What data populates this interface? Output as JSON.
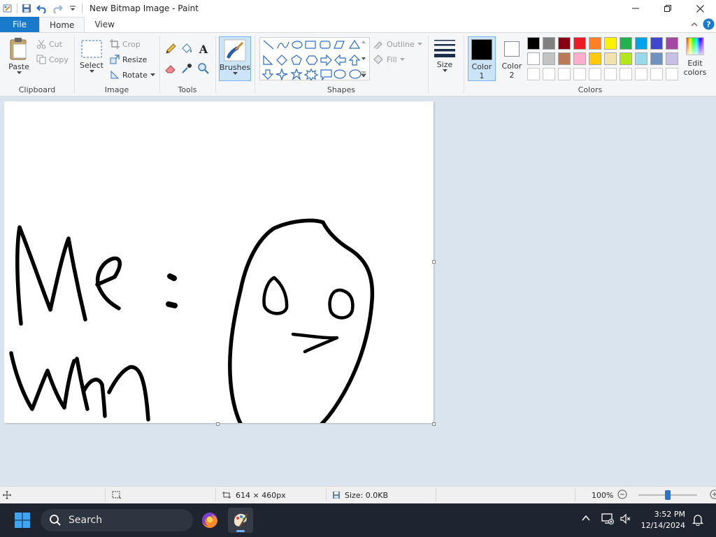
{
  "window": {
    "title": "New Bitmap Image - Paint",
    "buttons": {
      "minimize": "—",
      "maximize": "❐",
      "close": "✕"
    }
  },
  "menu": {
    "file": "File",
    "tabs": [
      "Home",
      "View"
    ]
  },
  "ribbon": {
    "clipboard": {
      "label": "Clipboard",
      "paste": "Paste",
      "cut": "Cut",
      "copy": "Copy"
    },
    "image": {
      "label": "Image",
      "select": "Select",
      "crop": "Crop",
      "resize": "Resize",
      "rotate": "Rotate"
    },
    "tools": {
      "label": "Tools",
      "brushes": "Brushes"
    },
    "shapes": {
      "label": "Shapes",
      "outline": "Outline",
      "fill": "Fill",
      "size": "Size"
    },
    "colors": {
      "label": "Colors",
      "color1_label": "Color",
      "color1_num": "1",
      "color2_label": "Color",
      "color2_num": "2",
      "edit_line1": "Edit",
      "edit_line2": "colors",
      "color1": "#000000",
      "color2": "#ffffff",
      "palette_row1": [
        "#000000",
        "#7f7f7f",
        "#880015",
        "#ed1c24",
        "#ff7f27",
        "#fff200",
        "#22b14c",
        "#00a2e8",
        "#3f48cc",
        "#a349a4"
      ],
      "palette_row2": [
        "#ffffff",
        "#c3c3c3",
        "#b97a57",
        "#ffaec9",
        "#ffc90e",
        "#efe4b0",
        "#b5e61d",
        "#99d9ea",
        "#7092be",
        "#c8bfe7"
      ]
    }
  },
  "canvas": {
    "stroke_color": "#000000"
  },
  "status": {
    "dimensions": "614 × 460px",
    "size": "Size: 0.0KB",
    "zoom": "100%",
    "zoom_level": 0.5
  },
  "taskbar": {
    "search": "Search",
    "time": "3:52 PM",
    "date": "12/14/2024"
  }
}
